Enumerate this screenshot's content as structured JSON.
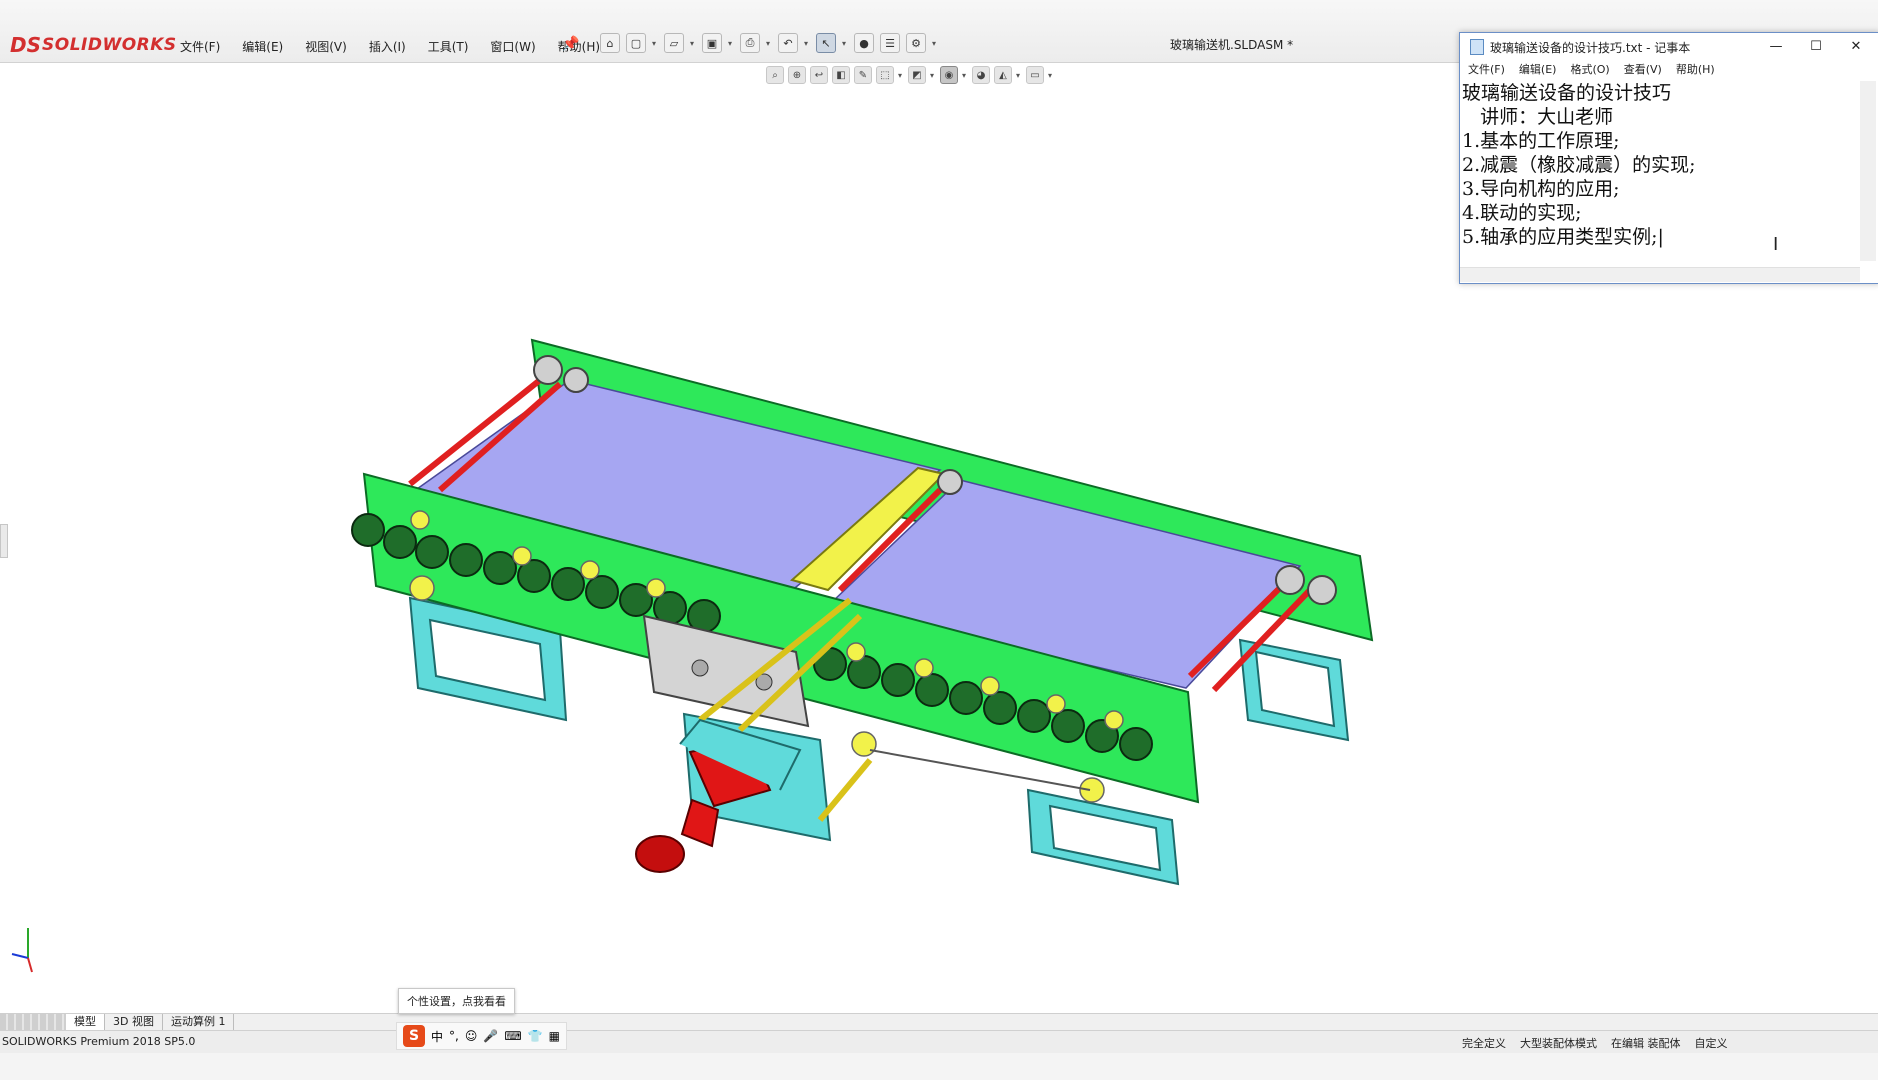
{
  "app": {
    "brand": "SOLIDWORKS",
    "document_title": "玻璃输送机.SLDASM *"
  },
  "menu": [
    "文件(F)",
    "编辑(E)",
    "视图(V)",
    "插入(I)",
    "工具(T)",
    "窗口(W)",
    "帮助(H)"
  ],
  "toolbar_icons": [
    "home-icon",
    "new-file-icon",
    "open-icon",
    "save-icon",
    "print-icon",
    "undo-icon",
    "select-icon",
    "rebuild-icon",
    "file-properties-icon",
    "options-icon"
  ],
  "view_toolbar_icons": [
    "zoom-to-fit-icon",
    "zoom-area-icon",
    "previous-view-icon",
    "section-view-icon",
    "dynamic-annotation-icon",
    "view-orientation-icon",
    "display-style-icon",
    "hide-show-icon",
    "edit-appearance-icon",
    "apply-scene-icon",
    "view-settings-icon"
  ],
  "notepad": {
    "title": "玻璃输送设备的设计技巧.txt - 记事本",
    "menu": [
      "文件(F)",
      "编辑(E)",
      "格式(O)",
      "查看(V)",
      "帮助(H)"
    ],
    "lines": [
      "玻璃输送设备的设计技巧",
      "   讲师：大山老师",
      "1.基本的工作原理;",
      "2.减震（橡胶减震）的实现;",
      "3.导向机构的应用;",
      "4.联动的实现;",
      "5.轴承的应用类型实例;|"
    ],
    "window_buttons": [
      "—",
      "☐",
      "✕"
    ]
  },
  "bottom_tabs": [
    "模型",
    "3D 视图",
    "运动算例 1"
  ],
  "status": {
    "product": "SOLIDWORKS Premium 2018 SP5.0",
    "right": [
      "完全定义",
      "大型装配体模式",
      "在编辑 装配体",
      "自定义"
    ]
  },
  "tooltip": "个性设置，点我看看",
  "ime": [
    "中",
    "°,",
    "☺",
    "🎤",
    "⌨",
    "👕",
    "▦"
  ],
  "colors": {
    "frame_green": "#2ee85a",
    "belt_blue": "#a6a6f2",
    "leg_cyan": "#5fdada",
    "roller_yellow": "#f2f24a",
    "shaft_red": "#e02020",
    "motor_red": "#e01616",
    "plate_gray": "#d4d4d4",
    "wheel_dark": "#1f6d2a"
  }
}
